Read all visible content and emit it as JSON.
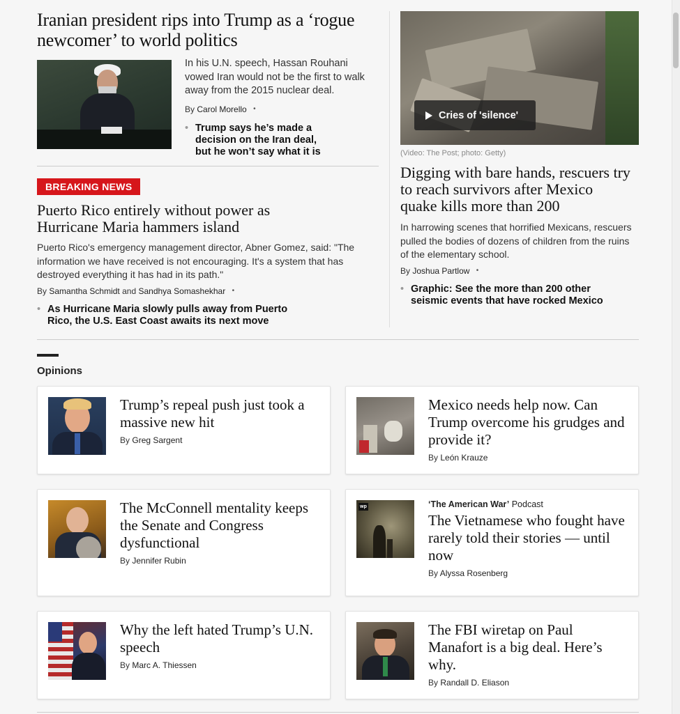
{
  "lead": {
    "headline": "Iranian president rips into Trump as a ‘rogue newcomer’ to world politics",
    "blurb": "In his U.N. speech, Hassan Rouhani vowed Iran would not be the first to walk away from the 2015 nuclear deal.",
    "byline_prefix": "By",
    "author": "Carol Morello",
    "related": "Trump says he’s made a decision on the Iran deal, but he won’t say what it is"
  },
  "breaking": {
    "label": "BREAKING NEWS",
    "headline": "Puerto Rico entirely without power as Hurricane Maria hammers island",
    "blurb": "Puerto Rico's emergency management director, Abner Gomez, said: \"The information we have received is not encouraging. It's a system that has destroyed everything it has had in its path.\"",
    "byline_prefix": "By",
    "author1": "Samantha Schmidt",
    "and": "and",
    "author2": "Sandhya Somashekhar",
    "related": "As Hurricane Maria slowly pulls away from Puerto Rico, the U.S. East Coast awaits its next move"
  },
  "mexico": {
    "video_label": "Cries of 'silence'",
    "credit": "(Video: The Post; photo: Getty)",
    "headline": "Digging with bare hands, rescuers try to reach survivors after Mexico quake kills more than 200",
    "blurb": "In harrowing scenes that horrified Mexicans, rescuers pulled the bodies of dozens of children from the ruins of the elementary school.",
    "byline_prefix": "By",
    "author": "Joshua Partlow",
    "related": "Graphic: See the more than 200 other seismic events that have rocked Mexico"
  },
  "opinions": {
    "section_title": "Opinions",
    "cards": [
      {
        "headline": "Trump’s repeal push just took a massive new hit",
        "byline_prefix": "By",
        "author": "Greg Sargent"
      },
      {
        "headline": "Mexico needs help now. Can Trump overcome his grudges and provide it?",
        "byline_prefix": "By",
        "author": "León Krauze"
      },
      {
        "headline": "The McConnell mentality keeps the Senate and Congress dysfunctional",
        "byline_prefix": "By",
        "author": "Jennifer Rubin"
      },
      {
        "kicker_bold": "‘The American War’",
        "kicker_rest": " Podcast",
        "headline": "The Vietnamese who fought have rarely told their stories — until now",
        "byline_prefix": "By",
        "author": "Alyssa Rosenberg"
      },
      {
        "headline": "Why the left hated Trump’s U.N. speech",
        "byline_prefix": "By",
        "author": "Marc A. Thiessen"
      },
      {
        "headline": "The FBI wiretap on Paul Manafort is a big deal. Here’s why.",
        "byline_prefix": "By",
        "author": "Randall D. Eliason"
      }
    ]
  },
  "icons": {
    "play": "play-icon",
    "bullet": "bullet-icon",
    "share": "share-dot-icon"
  },
  "colors": {
    "breaking": "#d6161b",
    "background": "#f6f6f6",
    "card": "#ffffff"
  }
}
